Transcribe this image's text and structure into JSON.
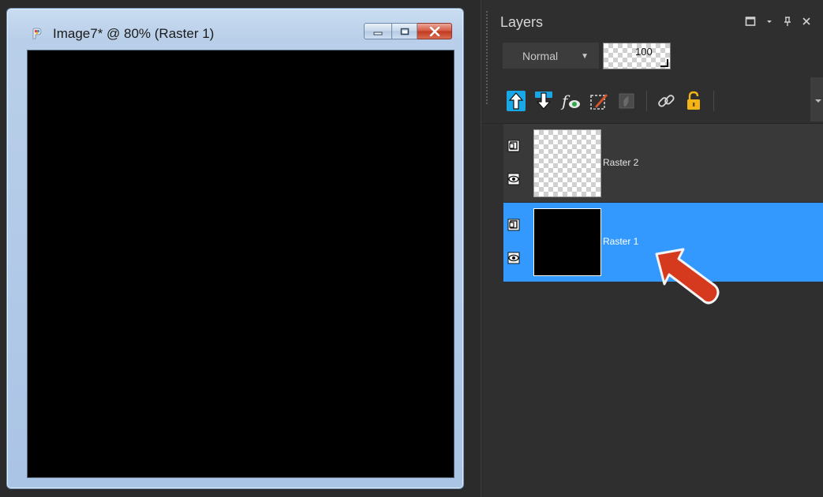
{
  "image_window": {
    "title": "Image7* @  80% (Raster 1)",
    "buttons": {
      "minimize": "minimize",
      "maximize": "maximize",
      "close": "close"
    }
  },
  "layers_panel": {
    "title": "Layers",
    "blend_mode": "Normal",
    "opacity": "100",
    "toolbar": [
      "move-layer-up-icon",
      "move-layer-down-icon",
      "layer-effects-icon",
      "edit-selection-icon",
      "mask-icon",
      "link-icon",
      "lock-icon"
    ],
    "layers": [
      {
        "name": "Raster 2",
        "selected": false
      },
      {
        "name": "Raster 1",
        "selected": true
      }
    ]
  },
  "colors": {
    "selected_layer": "#3399ff",
    "panel_bg": "#2f2f2f",
    "annotation_arrow": "#d63a1e"
  }
}
